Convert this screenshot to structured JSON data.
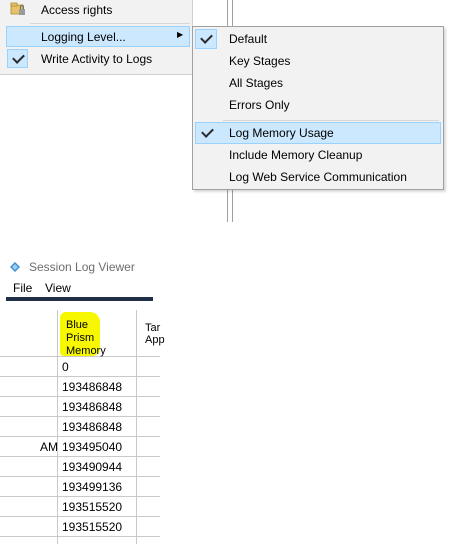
{
  "menu1": {
    "items": [
      {
        "label": "Access rights",
        "icon": "folder-lock-icon"
      },
      {
        "label": "Logging Level...",
        "submenu_arrow": "▶"
      },
      {
        "label": "Write Activity to Logs",
        "checked": true
      }
    ]
  },
  "submenu": {
    "items": [
      {
        "label": "Default",
        "checked": true
      },
      {
        "label": "Key Stages",
        "checked": false
      },
      {
        "label": "All Stages",
        "checked": false
      },
      {
        "label": "Errors Only",
        "checked": false
      },
      {
        "label": "Log Memory Usage",
        "checked": true,
        "highlighted": true
      },
      {
        "label": "Include Memory Cleanup",
        "checked": false
      },
      {
        "label": "Log Web Service Communication",
        "checked": false
      }
    ]
  },
  "viewer": {
    "title": "Session Log Viewer",
    "menu": [
      "File",
      "View"
    ],
    "col_header_line1": "Blue",
    "col_header_line2": "Prism",
    "col_header_line3": "Memory",
    "next_col_line1": "Tar",
    "next_col_line2": "App",
    "left_fragment": "AM",
    "rows": [
      "0",
      "193486848",
      "193486848",
      "193486848",
      "193495040",
      "193490944",
      "193499136",
      "193515520",
      "193515520"
    ]
  },
  "colors": {
    "highlight": "#cce8ff",
    "highlight_border": "#99d1ff",
    "marker": "#f7f700",
    "accent_bar": "#1f2f45"
  }
}
